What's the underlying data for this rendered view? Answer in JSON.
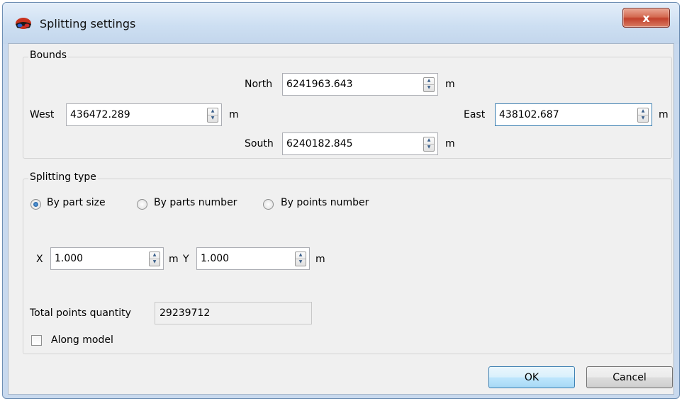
{
  "window": {
    "title": "Splitting settings",
    "close_label": "x"
  },
  "bounds": {
    "group_title": "Bounds",
    "north": {
      "label": "North",
      "value": "6241963.643",
      "unit": "m"
    },
    "west": {
      "label": "West",
      "value": "436472.289",
      "unit": "m"
    },
    "east": {
      "label": "East",
      "value": "438102.687",
      "unit": "m"
    },
    "south": {
      "label": "South",
      "value": "6240182.845",
      "unit": "m"
    }
  },
  "splitting": {
    "group_title": "Splitting type",
    "options": [
      {
        "label": "By part size",
        "checked": true
      },
      {
        "label": "By parts number",
        "checked": false
      },
      {
        "label": "By points number",
        "checked": false
      }
    ],
    "x": {
      "label": "X",
      "value": "1.000",
      "unit": "m"
    },
    "y": {
      "label": "Y",
      "value": "1.000",
      "unit": "m"
    },
    "total_points": {
      "label": "Total points quantity",
      "value": "29239712"
    },
    "along_model": {
      "label": "Along model",
      "checked": false
    }
  },
  "buttons": {
    "ok": "OK",
    "cancel": "Cancel"
  },
  "colors": {
    "accent": "#3c7fb1",
    "close": "#c2412c"
  }
}
